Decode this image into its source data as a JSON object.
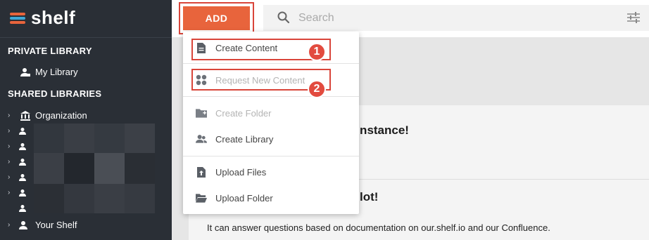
{
  "app": {
    "logo_text": "shelf"
  },
  "sidebar": {
    "private_title": "PRIVATE LIBRARY",
    "my_library": "My Library",
    "shared_title": "SHARED LIBRARIES",
    "organization": "Organization",
    "your_shelf": "Your Shelf"
  },
  "toolbar": {
    "add_label": "ADD"
  },
  "search": {
    "placeholder": "Search",
    "value": ""
  },
  "dropdown": {
    "items": [
      {
        "label": "Create Content",
        "icon": "document-icon",
        "enabled": true
      },
      {
        "label": "Request New Content",
        "icon": "grid-icon",
        "enabled": false
      },
      {
        "label": "Create Folder",
        "icon": "folder-add-icon",
        "enabled": false
      },
      {
        "label": "Create Library",
        "icon": "users-icon",
        "enabled": true
      },
      {
        "label": "Upload Files",
        "icon": "file-upload-icon",
        "enabled": true
      },
      {
        "label": "Upload Folder",
        "icon": "folder-open-icon",
        "enabled": true
      }
    ]
  },
  "annotations": {
    "badge1": "1",
    "badge2": "2"
  },
  "main": {
    "card1_title": "r Instance!",
    "card2_title": "lot!",
    "card2_text": "It can answer questions based on documentation on our.shelf.io and our Confluence."
  },
  "colors": {
    "accent": "#e8643c",
    "sidebar_bg": "#2a2f36",
    "highlight": "#d9453a"
  }
}
